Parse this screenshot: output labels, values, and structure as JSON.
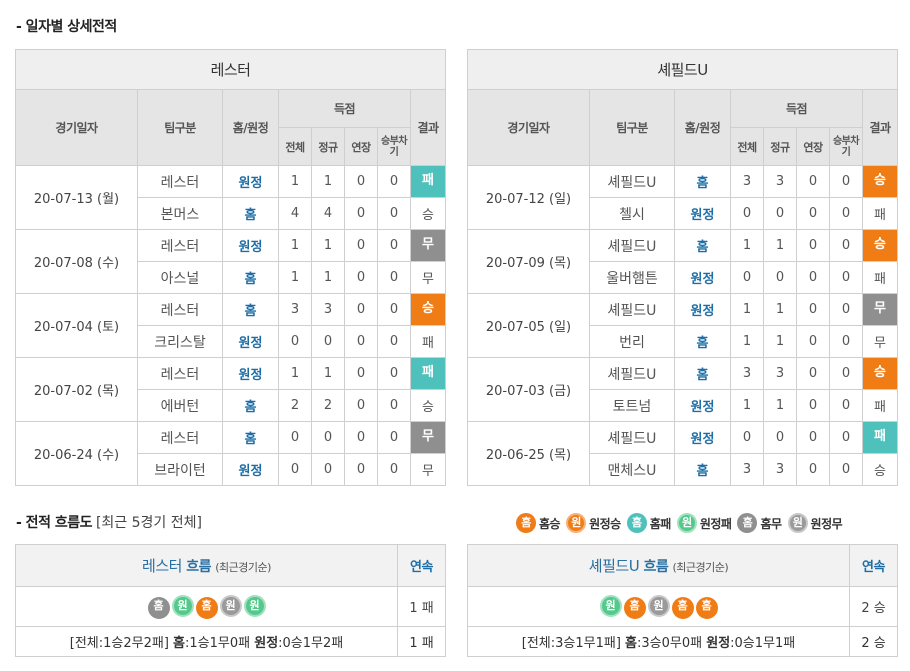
{
  "section1_title": "- 일자별 상세전적",
  "headers": {
    "date": "경기일자",
    "team": "팀구분",
    "home_away": "홈/원정",
    "score": "득점",
    "result": "결과",
    "total": "전체",
    "regular": "정규",
    "extra": "연장",
    "shootout": "승부차기"
  },
  "left": {
    "team_name": "레스터",
    "matches": [
      {
        "date": "20-07-13 (월)",
        "rows": [
          {
            "team": "레스터",
            "ha": "원정",
            "total": "1",
            "regular": "1",
            "extra": "0",
            "so": "0",
            "result": "패",
            "style": "lose"
          },
          {
            "team": "본머스",
            "ha": "홈",
            "total": "4",
            "regular": "4",
            "extra": "0",
            "so": "0",
            "result": "승",
            "style": "plain"
          }
        ]
      },
      {
        "date": "20-07-08 (수)",
        "rows": [
          {
            "team": "레스터",
            "ha": "원정",
            "total": "1",
            "regular": "1",
            "extra": "0",
            "so": "0",
            "result": "무",
            "style": "draw"
          },
          {
            "team": "아스널",
            "ha": "홈",
            "total": "1",
            "regular": "1",
            "extra": "0",
            "so": "0",
            "result": "무",
            "style": "plain"
          }
        ]
      },
      {
        "date": "20-07-04 (토)",
        "rows": [
          {
            "team": "레스터",
            "ha": "홈",
            "total": "3",
            "regular": "3",
            "extra": "0",
            "so": "0",
            "result": "승",
            "style": "win"
          },
          {
            "team": "크리스탈",
            "ha": "원정",
            "total": "0",
            "regular": "0",
            "extra": "0",
            "so": "0",
            "result": "패",
            "style": "plain"
          }
        ]
      },
      {
        "date": "20-07-02 (목)",
        "rows": [
          {
            "team": "레스터",
            "ha": "원정",
            "total": "1",
            "regular": "1",
            "extra": "0",
            "so": "0",
            "result": "패",
            "style": "lose"
          },
          {
            "team": "에버턴",
            "ha": "홈",
            "total": "2",
            "regular": "2",
            "extra": "0",
            "so": "0",
            "result": "승",
            "style": "plain"
          }
        ]
      },
      {
        "date": "20-06-24 (수)",
        "rows": [
          {
            "team": "레스터",
            "ha": "홈",
            "total": "0",
            "regular": "0",
            "extra": "0",
            "so": "0",
            "result": "무",
            "style": "draw"
          },
          {
            "team": "브라이턴",
            "ha": "원정",
            "total": "0",
            "regular": "0",
            "extra": "0",
            "so": "0",
            "result": "무",
            "style": "plain"
          }
        ]
      }
    ]
  },
  "right": {
    "team_name": "셰필드U",
    "matches": [
      {
        "date": "20-07-12 (일)",
        "rows": [
          {
            "team": "셰필드U",
            "ha": "홈",
            "total": "3",
            "regular": "3",
            "extra": "0",
            "so": "0",
            "result": "승",
            "style": "win"
          },
          {
            "team": "첼시",
            "ha": "원정",
            "total": "0",
            "regular": "0",
            "extra": "0",
            "so": "0",
            "result": "패",
            "style": "plain"
          }
        ]
      },
      {
        "date": "20-07-09 (목)",
        "rows": [
          {
            "team": "셰필드U",
            "ha": "홈",
            "total": "1",
            "regular": "1",
            "extra": "0",
            "so": "0",
            "result": "승",
            "style": "win"
          },
          {
            "team": "울버햄튼",
            "ha": "원정",
            "total": "0",
            "regular": "0",
            "extra": "0",
            "so": "0",
            "result": "패",
            "style": "plain"
          }
        ]
      },
      {
        "date": "20-07-05 (일)",
        "rows": [
          {
            "team": "셰필드U",
            "ha": "원정",
            "total": "1",
            "regular": "1",
            "extra": "0",
            "so": "0",
            "result": "무",
            "style": "draw"
          },
          {
            "team": "번리",
            "ha": "홈",
            "total": "1",
            "regular": "1",
            "extra": "0",
            "so": "0",
            "result": "무",
            "style": "plain"
          }
        ]
      },
      {
        "date": "20-07-03 (금)",
        "rows": [
          {
            "team": "셰필드U",
            "ha": "홈",
            "total": "3",
            "regular": "3",
            "extra": "0",
            "so": "0",
            "result": "승",
            "style": "win"
          },
          {
            "team": "토트넘",
            "ha": "원정",
            "total": "1",
            "regular": "1",
            "extra": "0",
            "so": "0",
            "result": "패",
            "style": "plain"
          }
        ]
      },
      {
        "date": "20-06-25 (목)",
        "rows": [
          {
            "team": "셰필드U",
            "ha": "원정",
            "total": "0",
            "regular": "0",
            "extra": "0",
            "so": "0",
            "result": "패",
            "style": "lose"
          },
          {
            "team": "맨체스U",
            "ha": "홈",
            "total": "3",
            "regular": "3",
            "extra": "0",
            "so": "0",
            "result": "승",
            "style": "plain"
          }
        ]
      }
    ]
  },
  "section2_title": "- 전적 흐름도",
  "section2_sub": "[최근 5경기 전체]",
  "legend": [
    {
      "glyph": "홈",
      "label": "홈승",
      "cls": "c-orange"
    },
    {
      "glyph": "원",
      "label": "원정승",
      "cls": "c-orange-o"
    },
    {
      "glyph": "홈",
      "label": "홈패",
      "cls": "c-teal"
    },
    {
      "glyph": "원",
      "label": "원정패",
      "cls": "c-teal-o"
    },
    {
      "glyph": "홈",
      "label": "홈무",
      "cls": "c-gray"
    },
    {
      "glyph": "원",
      "label": "원정무",
      "cls": "c-gray-o"
    }
  ],
  "flow_left": {
    "team": "레스터",
    "flow_word": "흐름",
    "note": "(최근경기순)",
    "streak_header": "연속",
    "circles": [
      {
        "glyph": "홈",
        "cls": "c-gray"
      },
      {
        "glyph": "원",
        "cls": "c-teal-o"
      },
      {
        "glyph": "홈",
        "cls": "c-orange"
      },
      {
        "glyph": "원",
        "cls": "c-gray-o"
      },
      {
        "glyph": "원",
        "cls": "c-teal-o"
      }
    ],
    "streak": "1 패",
    "summary_total": "[전체:1승2무2패]",
    "summary_home_label": "홈",
    "summary_home": ":1승1무0패",
    "summary_away_label": "원정",
    "summary_away": ":0승1무2패",
    "summary_streak": "1 패"
  },
  "flow_right": {
    "team": "셰필드U",
    "flow_word": "흐름",
    "note": "(최근경기순)",
    "streak_header": "연속",
    "circles": [
      {
        "glyph": "원",
        "cls": "c-teal-o"
      },
      {
        "glyph": "홈",
        "cls": "c-orange"
      },
      {
        "glyph": "원",
        "cls": "c-gray-o"
      },
      {
        "glyph": "홈",
        "cls": "c-orange"
      },
      {
        "glyph": "홈",
        "cls": "c-orange"
      }
    ],
    "streak": "2 승",
    "summary_total": "[전체:3승1무1패]",
    "summary_home_label": "홈",
    "summary_home": ":3승0무0패",
    "summary_away_label": "원정",
    "summary_away": ":0승1무1패",
    "summary_streak": "2 승"
  }
}
